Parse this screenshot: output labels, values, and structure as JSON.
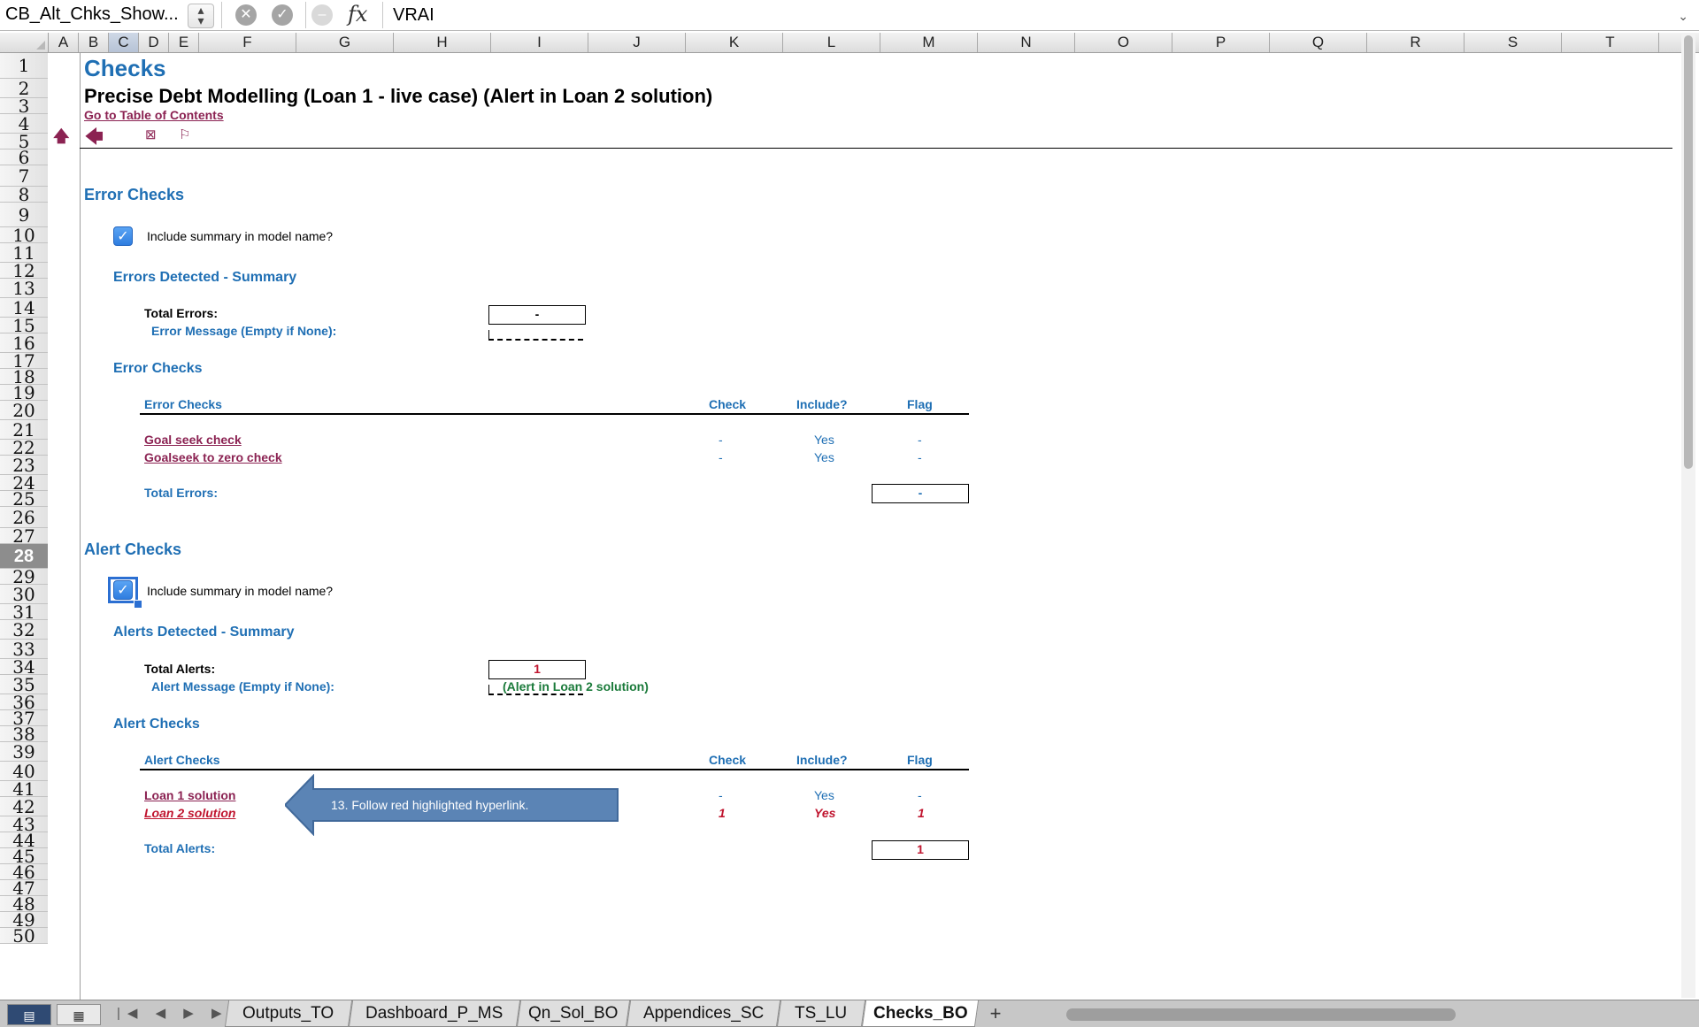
{
  "formula_bar": {
    "name_box": "CB_Alt_Chks_Show...",
    "cancel_icon": "cancel-icon",
    "enter_icon": "enter-icon",
    "fx_label": "fx",
    "value": "VRAI"
  },
  "columns": [
    "A",
    "B",
    "C",
    "D",
    "E",
    "F",
    "G",
    "H",
    "I",
    "J",
    "K",
    "L",
    "M",
    "N",
    "O",
    "P",
    "Q",
    "R",
    "S",
    "T"
  ],
  "selected_column": "C",
  "rows": [
    "1",
    "2",
    "3",
    "4",
    "5",
    "6",
    "7",
    "8",
    "9",
    "10",
    "11",
    "12",
    "13",
    "14",
    "15",
    "16",
    "17",
    "18",
    "19",
    "20",
    "21",
    "22",
    "23",
    "24",
    "25",
    "26",
    "27",
    "28",
    "29",
    "30",
    "31",
    "32",
    "33",
    "34",
    "35",
    "36",
    "37",
    "38",
    "39",
    "40",
    "41",
    "42",
    "43",
    "44",
    "45",
    "46",
    "47",
    "48",
    "49",
    "50"
  ],
  "selected_row": "28",
  "sheet": {
    "title": "Checks",
    "subtitle": "Precise Debt Modelling (Loan 1 - live case) (Alert in Loan 2 solution)",
    "toc_link": "Go to Table of Contents",
    "nav_icons": [
      "up-arrow-icon",
      "back-arrow-icon",
      "close-box-icon",
      "flag-icon"
    ],
    "error_section": {
      "heading": "Error Checks",
      "checkbox_checked": true,
      "checkbox_label": "Include summary in model name?",
      "summary_heading": "Errors Detected - Summary",
      "total_label": "Total Errors:",
      "total_value": "-",
      "message_label": "Error Message (Empty if None):",
      "message_value": "",
      "table_heading": "Error Checks",
      "col_name": "Error Checks",
      "col_check": "Check",
      "col_include": "Include?",
      "col_flag": "Flag",
      "items": [
        {
          "name": "Goal seek check",
          "check": "-",
          "include": "Yes",
          "flag": "-"
        },
        {
          "name": "Goalseek to zero check",
          "check": "-",
          "include": "Yes",
          "flag": "-"
        }
      ],
      "table_total_label": "Total Errors:",
      "table_total_value": "-"
    },
    "alert_section": {
      "heading": "Alert Checks",
      "checkbox_checked": true,
      "checkbox_label": "Include summary in model name?",
      "summary_heading": "Alerts Detected - Summary",
      "total_label": "Total Alerts:",
      "total_value": "1",
      "message_label": "Alert Message (Empty if None):",
      "message_value": "(Alert in Loan 2 solution)",
      "table_heading": "Alert Checks",
      "col_name": "Alert Checks",
      "col_check": "Check",
      "col_include": "Include?",
      "col_flag": "Flag",
      "items": [
        {
          "name": "Loan 1 solution",
          "check": "-",
          "include": "Yes",
          "flag": "-"
        },
        {
          "name": "Loan 2 solution",
          "check": "1",
          "include": "Yes",
          "flag": "1"
        }
      ],
      "table_total_label": "Total Alerts:",
      "table_total_value": "1"
    },
    "callout_text": "13. Follow red highlighted hyperlink."
  },
  "tabs": {
    "nav": "|◀ ◀ ▶ ▶|",
    "items": [
      "Outputs_TO",
      "Dashboard_P_MS",
      "Qn_Sol_BO",
      "Appendices_SC",
      "TS_LU",
      "Checks_BO"
    ],
    "active": "Checks_BO",
    "add_label": "+"
  },
  "colors": {
    "accent_blue": "#1f6fb4",
    "link_maroon": "#8b2252",
    "alert_red": "#c0152f",
    "message_green": "#1a7a3a"
  }
}
